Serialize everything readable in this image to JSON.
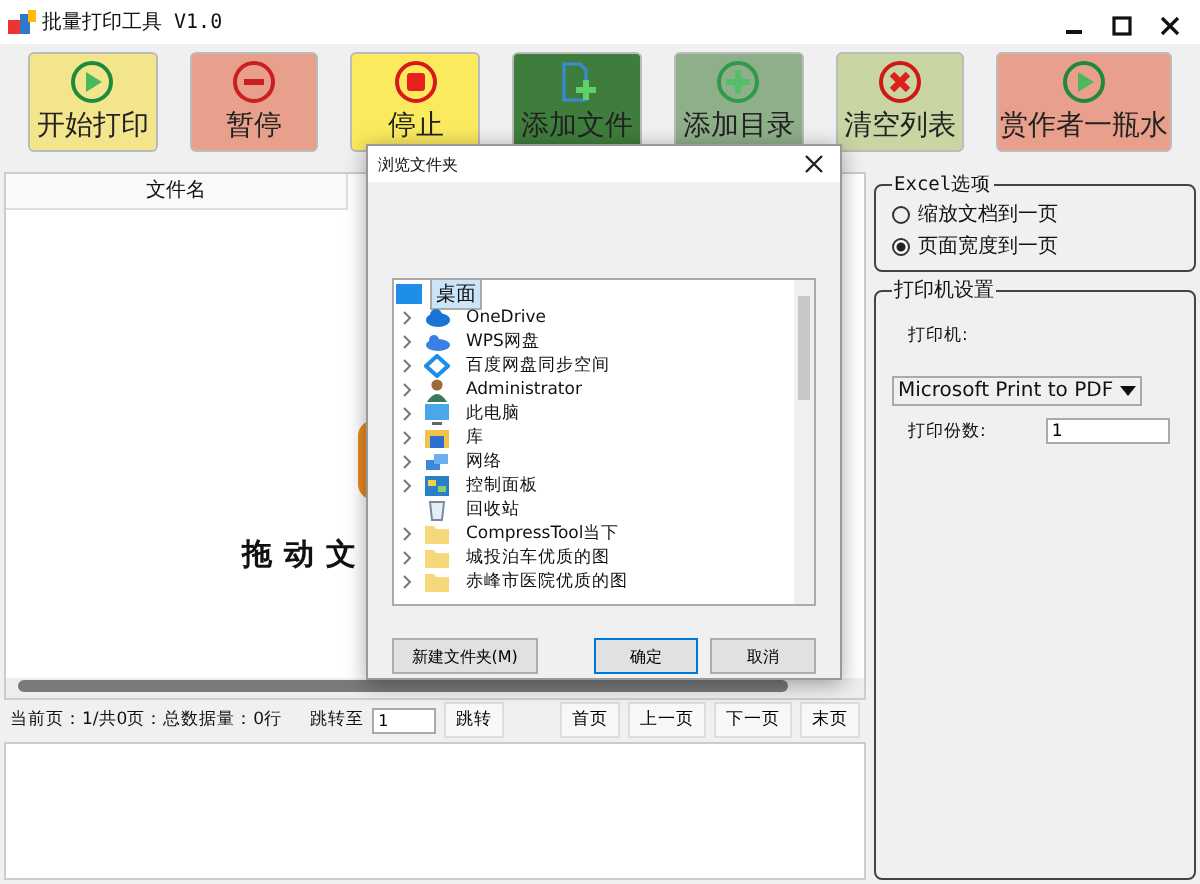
{
  "window": {
    "title": "批量打印工具 V1.0"
  },
  "toolbar": [
    {
      "label": "开始打印",
      "color": "#f3e58c"
    },
    {
      "label": "暂停",
      "color": "#e8a08c"
    },
    {
      "label": "停止",
      "color": "#fbe95e"
    },
    {
      "label": "添加文件",
      "color": "#3f7d3c"
    },
    {
      "label": "添加目录",
      "color": "#8fae8a"
    },
    {
      "label": "清空列表",
      "color": "#c9d6a3"
    },
    {
      "label": "赏作者一瓶水",
      "color": "#e8a08c"
    }
  ],
  "file_table": {
    "columns": [
      "文件名"
    ],
    "hint": "拖动文"
  },
  "pager": {
    "status": "当前页：1/共0页：总数据量：0行",
    "jump_label": "跳转至",
    "jump_value": "1",
    "jump_button": "跳转",
    "buttons": [
      "首页",
      "上一页",
      "下一页",
      "末页"
    ]
  },
  "excel_options": {
    "title": "Excel选项",
    "options": [
      {
        "label": "缩放文档到一页",
        "selected": false
      },
      {
        "label": "页面宽度到一页",
        "selected": true
      }
    ]
  },
  "printer_settings": {
    "title": "打印机设置",
    "printer_label": "打印机:",
    "printer": "Microsoft Print to PDF",
    "copies_label": "打印份数:",
    "copies": "1"
  },
  "dialog": {
    "title": "浏览文件夹",
    "tree": [
      {
        "label": "桌面",
        "selected": true,
        "children": [
          {
            "label": "OneDrive",
            "expandable": true
          },
          {
            "label": "WPS网盘",
            "expandable": true
          },
          {
            "label": "百度网盘同步空间",
            "expandable": true
          },
          {
            "label": "Administrator",
            "expandable": true
          },
          {
            "label": "此电脑",
            "expandable": true
          },
          {
            "label": "库",
            "expandable": true
          },
          {
            "label": "网络",
            "expandable": true
          },
          {
            "label": "控制面板",
            "expandable": true
          },
          {
            "label": "回收站",
            "expandable": false
          },
          {
            "label": "CompressTool当下",
            "expandable": true
          },
          {
            "label": "城投泊车优质的图",
            "expandable": true
          },
          {
            "label": "赤峰市医院优质的图",
            "expandable": true
          }
        ]
      }
    ],
    "buttons": [
      {
        "label": "新建文件夹(M)",
        "selected": false
      },
      {
        "label": "确定",
        "selected": true
      },
      {
        "label": "取消",
        "selected": false
      }
    ]
  }
}
